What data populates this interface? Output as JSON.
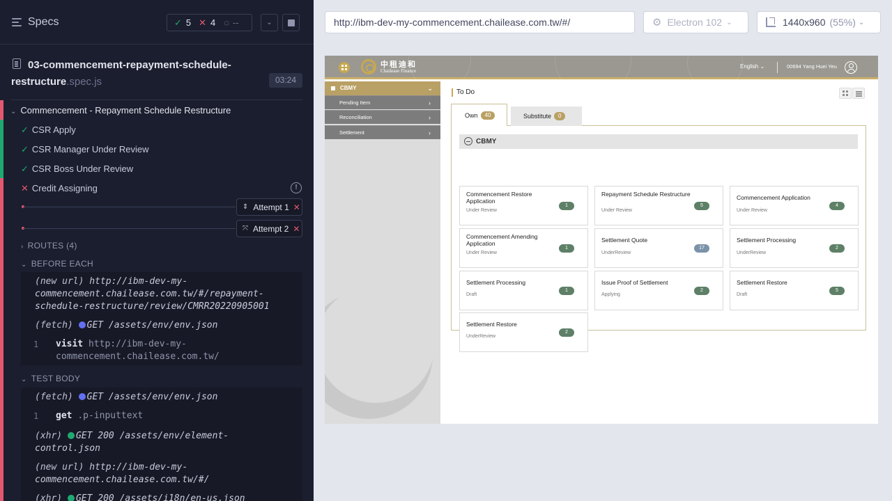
{
  "runner": {
    "title": "Specs",
    "stats": {
      "passed": "5",
      "failed": "4",
      "pending": "--"
    },
    "spec": {
      "name": "03-commencement-repayment-schedule-restructure",
      "ext": ".spec.js",
      "duration": "03:24"
    },
    "suite": "Commencement - Repayment Schedule Restructure",
    "tests": [
      {
        "label": "CSR Apply",
        "state": "passed"
      },
      {
        "label": "CSR Manager Under Review",
        "state": "passed"
      },
      {
        "label": "CSR Boss Under Review",
        "state": "passed"
      },
      {
        "label": "Credit Assigning",
        "state": "failed"
      }
    ],
    "attempts": [
      {
        "label": "Attempt 1"
      },
      {
        "label": "Attempt 2"
      }
    ],
    "routes_label": "ROUTES (4)",
    "before_each_label": "BEFORE EACH",
    "test_body_label": "TEST BODY",
    "before_each": {
      "new_url_label": "(new url)",
      "new_url_value": "http://ibm-dev-my-commencement.chailease.com.tw/#/repayment-schedule-restructure/review/CMRR20220905001",
      "fetch_label": "(fetch)",
      "fetch_value": "GET /assets/env/env.json",
      "visit_num": "1",
      "visit_label": "visit",
      "visit_value": "http://ibm-dev-my-commencement.chailease.com.tw/"
    },
    "test_body": {
      "fetch_label": "(fetch)",
      "fetch_value": "GET /assets/env/env.json",
      "get_num": "1",
      "get_label": "get",
      "get_value": ".p-inputtext",
      "xhr1_label": "(xhr)",
      "xhr1_value": "GET 200 /assets/env/element-control.json",
      "new_url_label": "(new url)",
      "new_url_value": "http://ibm-dev-my-commencement.chailease.com.tw/#/",
      "xhr2_label": "(xhr)",
      "xhr2_value": "GET 200 /assets/i18n/en-us.json"
    }
  },
  "browser": {
    "url": "http://ibm-dev-my-commencement.chailease.com.tw/#/",
    "name": "Electron 102",
    "viewport": "1440x960",
    "scale": "(55%)"
  },
  "app": {
    "logo_cn": "中租迪和",
    "logo_en": "Chailease Finance",
    "language": "English",
    "user": "00694 Yang Huei Yeu",
    "sidebar": {
      "header": "CBMY",
      "items": [
        {
          "label": "Pending Item"
        },
        {
          "label": "Reconciliation"
        },
        {
          "label": "Settlement"
        }
      ]
    },
    "page_title": "To Do",
    "tabs": [
      {
        "label": "Own",
        "count": "40"
      },
      {
        "label": "Substitute",
        "count": "0"
      }
    ],
    "group": "CBMY",
    "cards": [
      {
        "title": "Commencement Restore Application",
        "status": "Under Review",
        "count": "1"
      },
      {
        "title": "Repayment Schedule Restructure",
        "status": "Under Review",
        "count": "5"
      },
      {
        "title": "Commencement Application",
        "status": "Under Review",
        "count": "4"
      },
      {
        "title": "Commencement Amending Application",
        "status": "Under Review",
        "count": "1"
      },
      {
        "title": "Settlement Quote",
        "status": "UnderReview",
        "count": "17"
      },
      {
        "title": "Settlement Processing",
        "status": "UnderReview",
        "count": "2"
      },
      {
        "title": "Settlement Processing",
        "status": "Draft",
        "count": "1"
      },
      {
        "title": "Issue Proof of Settlement",
        "status": "Applying",
        "count": "2"
      },
      {
        "title": "Settlement Restore",
        "status": "Draft",
        "count": "5"
      },
      {
        "title": "Settlement Restore",
        "status": "UnderReview",
        "count": "2"
      }
    ]
  }
}
